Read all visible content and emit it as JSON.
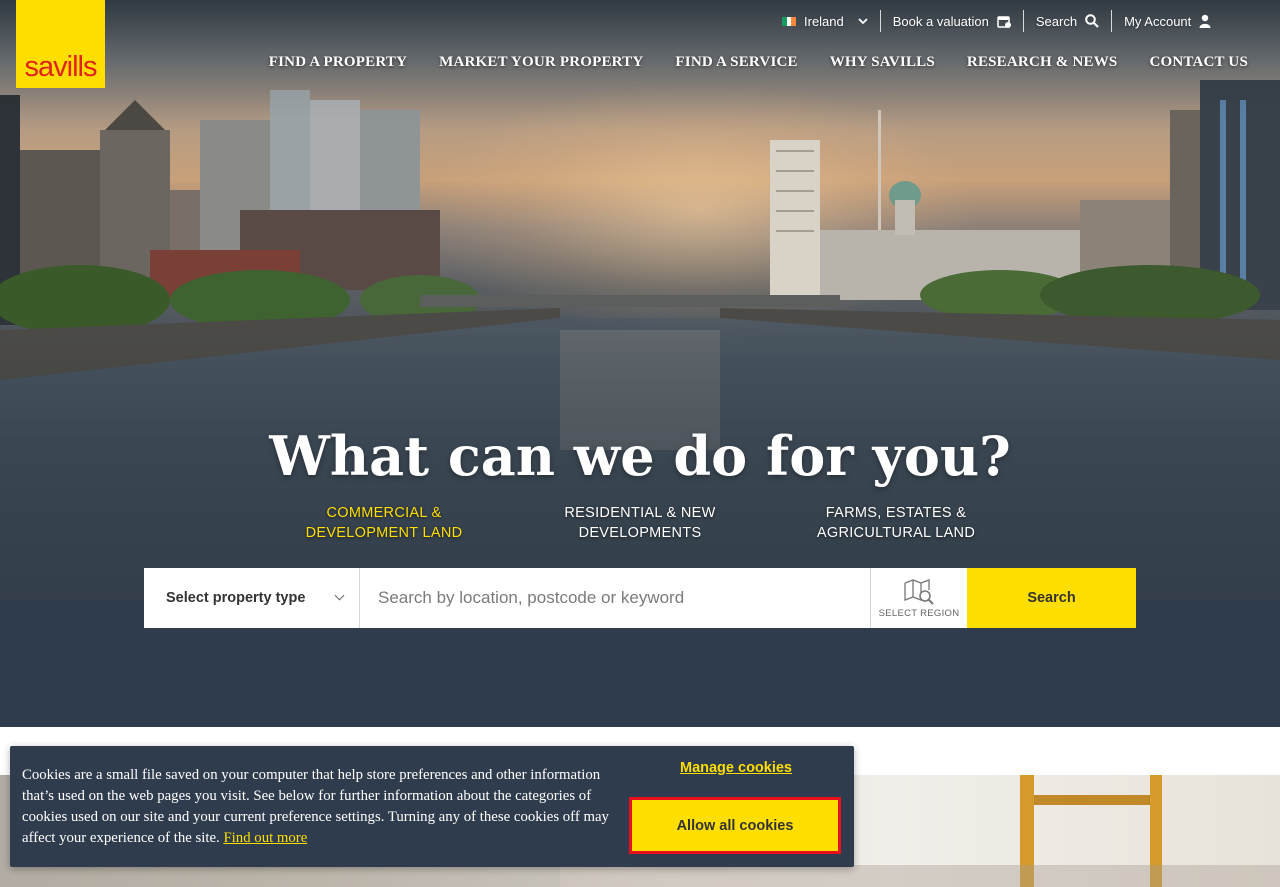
{
  "brand": {
    "logo_text": "savills",
    "yellow": "#ffde00",
    "red": "#e2231a",
    "navy": "#2f3c4d"
  },
  "utility": {
    "country": "Ireland",
    "book_valuation": "Book a valuation",
    "search": "Search",
    "my_account": "My Account"
  },
  "nav": [
    {
      "label": "FIND A PROPERTY"
    },
    {
      "label": "MARKET YOUR PROPERTY"
    },
    {
      "label": "FIND A SERVICE"
    },
    {
      "label": "WHY SAVILLS"
    },
    {
      "label": "RESEARCH & NEWS"
    },
    {
      "label": "CONTACT US"
    }
  ],
  "hero": {
    "headline": "What can we do for you?",
    "sectors": [
      {
        "line1": "COMMERCIAL &",
        "line2": "DEVELOPMENT LAND",
        "active": true
      },
      {
        "line1": "RESIDENTIAL & NEW",
        "line2": "DEVELOPMENTS",
        "active": false
      },
      {
        "line1": "FARMS, ESTATES &",
        "line2": "AGRICULTURAL LAND",
        "active": false
      }
    ]
  },
  "search": {
    "property_type": "Select property type",
    "placeholder": "Search by location, postcode or keyword",
    "region_label": "SELECT REGION",
    "button": "Search"
  },
  "cookie": {
    "text": "Cookies are a small file saved on your computer that help store preferences and other information that’s used on the web pages you visit. See below for further information about the categories of cookies used on our site and your current preference settings. Turning any of these cookies off may affect your experience of the site.",
    "find_out_more": "Find out more",
    "manage": "Manage cookies",
    "allow_all": "Allow all cookies"
  }
}
